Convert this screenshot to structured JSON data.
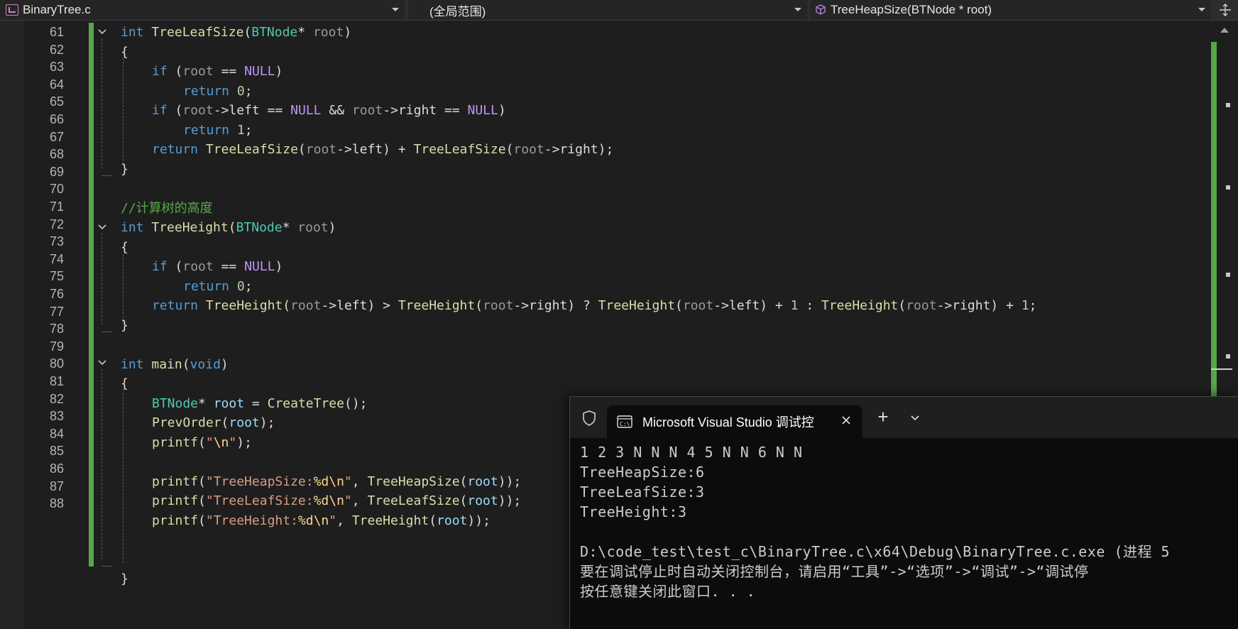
{
  "navbar": {
    "project_file": "BinaryTree.c",
    "scope": "(全局范围)",
    "function": "TreeHeapSize(BTNode * root)"
  },
  "editor": {
    "line_numbers": [
      "61",
      "62",
      "63",
      "64",
      "65",
      "66",
      "67",
      "68",
      "69",
      "70",
      "71",
      "72",
      "73",
      "74",
      "75",
      "76",
      "77",
      "78",
      "79",
      "80",
      "81",
      "82",
      "83",
      "84",
      "85",
      "86",
      "87",
      "88"
    ],
    "comment_line": "//计算树的高度"
  },
  "terminal": {
    "tab_title": "Microsoft Visual Studio 调试控",
    "output": [
      "1 2 3 N N N 4 5 N N 6 N N",
      "TreeHeapSize:6",
      "TreeLeafSize:3",
      "TreeHeight:3",
      "",
      "D:\\code_test\\test_c\\BinaryTree.c\\x64\\Debug\\BinaryTree.c.exe (进程 5",
      "要在调试停止时自动关闭控制台，请启用“工具”->“选项”->“调试”->“调试停",
      "按任意键关闭此窗口. . ."
    ]
  },
  "colors": {
    "background": "#1e1e1e",
    "keyword": "#569cd6",
    "function": "#dcdcaa",
    "type": "#4ec9b0",
    "string": "#d69d85",
    "comment": "#57a64a",
    "change_bar": "#57a64a"
  },
  "icons": [
    "file-icon",
    "cube-icon",
    "split-icon",
    "fold-chevron-icon",
    "shield-icon",
    "terminal-tab-icon",
    "close-icon",
    "plus-icon",
    "chevron-down-icon"
  ]
}
